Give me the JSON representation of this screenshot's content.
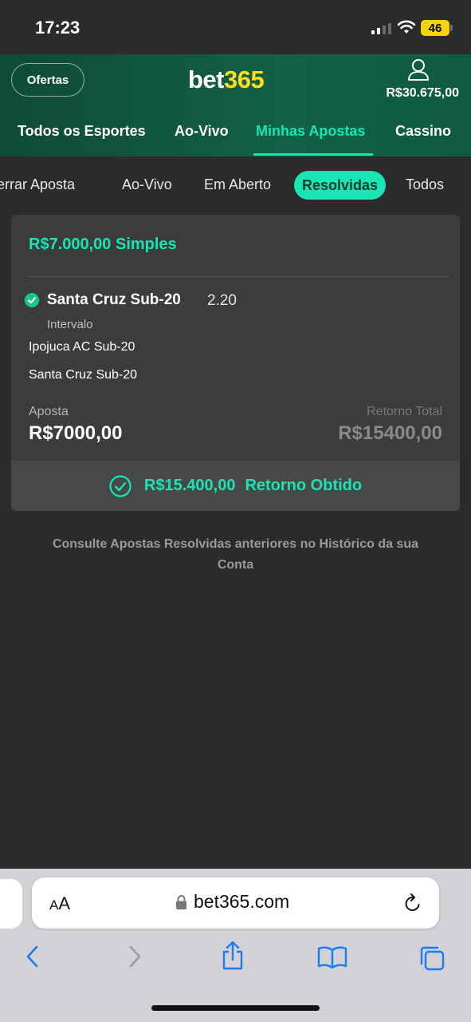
{
  "status_bar": {
    "time": "17:23",
    "battery": "46",
    "icons": [
      "signal-icon",
      "wifi-icon",
      "battery-icon"
    ]
  },
  "header": {
    "offers_label": "Ofertas",
    "logo_main": "bet",
    "logo_accent": "365",
    "balance": "R$30.675,00",
    "brand_colors": {
      "green": "#126047",
      "accent": "#18e5b3",
      "logo_yellow": "#ffdf1b"
    }
  },
  "main_nav": {
    "items": [
      {
        "label": "Todos os Esportes"
      },
      {
        "label": "Ao-Vivo"
      },
      {
        "label": "Minhas Apostas",
        "active": true
      },
      {
        "label": "Cassino"
      }
    ]
  },
  "sub_tabs": {
    "items": [
      {
        "label": "errar Aposta"
      },
      {
        "label": "Ao-Vivo"
      },
      {
        "label": "Em Aberto"
      },
      {
        "label": "Resolvidas",
        "active": true
      },
      {
        "label": "Todos"
      }
    ]
  },
  "bet": {
    "title": "R$7.000,00 Simples",
    "selection": "Santa Cruz Sub-20",
    "odds": "2.20",
    "market": "Intervalo",
    "team_home": "Ipojuca AC Sub-20",
    "team_away": "Santa Cruz Sub-20",
    "stake_label": "Aposta",
    "stake_value": "R$7000,00",
    "return_label": "Retorno Total",
    "return_value": "R$15400,00",
    "payout_amount": "R$15.400,00",
    "payout_label": "Retorno Obtido"
  },
  "note": "Consulte Apostas Resolvidas anteriores no Histórico da sua Conta",
  "browser": {
    "aa_small": "A",
    "aa_big": "A",
    "url": "bet365.com",
    "toolbar_icons": [
      "back-icon",
      "forward-icon",
      "share-icon",
      "bookmarks-icon",
      "tabs-icon"
    ]
  }
}
